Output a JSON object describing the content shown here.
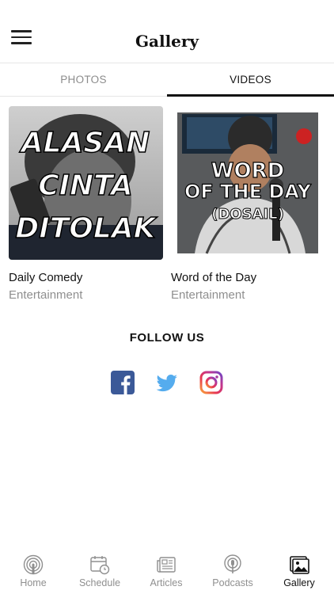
{
  "header": {
    "title": "Gallery"
  },
  "tabs": {
    "photos": "PHOTOS",
    "videos": "VIDEOS",
    "active": "videos"
  },
  "videos": [
    {
      "title": "Daily Comedy",
      "category": "Entertainment",
      "thumb_lines": [
        "ALASAN",
        "CINTA",
        "DITOLAK"
      ]
    },
    {
      "title": "Word of the Day",
      "category": "Entertainment",
      "thumb_lines": [
        "WORD",
        "OF THE DAY",
        "(DOSAIL)"
      ]
    }
  ],
  "follow": {
    "heading": "FOLLOW US",
    "icons": [
      "facebook-icon",
      "twitter-icon",
      "instagram-icon"
    ]
  },
  "tabbar": [
    {
      "label": "Home",
      "icon": "podcast-signal-icon"
    },
    {
      "label": "Schedule",
      "icon": "calendar-clock-icon"
    },
    {
      "label": "Articles",
      "icon": "newspaper-icon"
    },
    {
      "label": "Podcasts",
      "icon": "microphone-icon"
    },
    {
      "label": "Gallery",
      "icon": "image-gallery-icon"
    }
  ],
  "active_tab": "Gallery",
  "colors": {
    "facebook": "#3b5998",
    "twitter": "#55acee",
    "active": "#111111",
    "inactive": "#8f8f8f"
  }
}
